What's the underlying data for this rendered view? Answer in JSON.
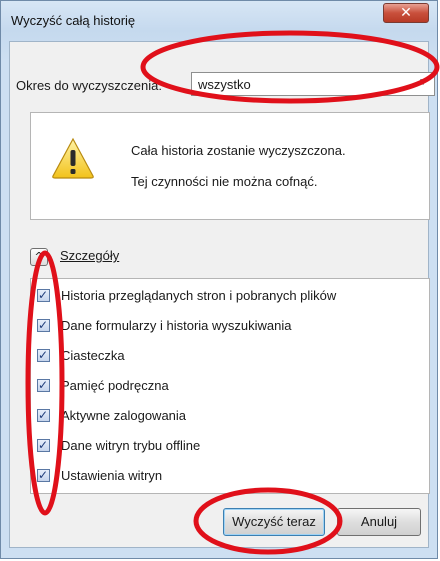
{
  "window": {
    "title": "Wyczyść całą historię",
    "close_glyph": "✕"
  },
  "range": {
    "label": "Okres do wyczyszczenia:",
    "selected": "wszystko"
  },
  "warning": {
    "icon": "warning-icon",
    "line1": "Cała historia zostanie wyczyszczona.",
    "line2": "Tej czynności nie można cofnąć."
  },
  "details": {
    "label": "Szczegóły",
    "toggle_glyph": "^"
  },
  "items": [
    {
      "label": "Historia przeglądanych stron i pobranych plików",
      "checked": true
    },
    {
      "label": "Dane formularzy i historia wyszukiwania",
      "checked": true
    },
    {
      "label": "Ciasteczka",
      "checked": true
    },
    {
      "label": "Pamięć podręczna",
      "checked": true
    },
    {
      "label": "Aktywne zalogowania",
      "checked": true
    },
    {
      "label": "Dane witryn trybu offline",
      "checked": true
    },
    {
      "label": "Ustawienia witryn",
      "checked": true
    }
  ],
  "check_glyph": "✓",
  "buttons": {
    "clear": "Wyczyść teraz",
    "cancel": "Anuluj"
  },
  "colors": {
    "annotation": "#e0101a",
    "close": "#c9503c"
  }
}
